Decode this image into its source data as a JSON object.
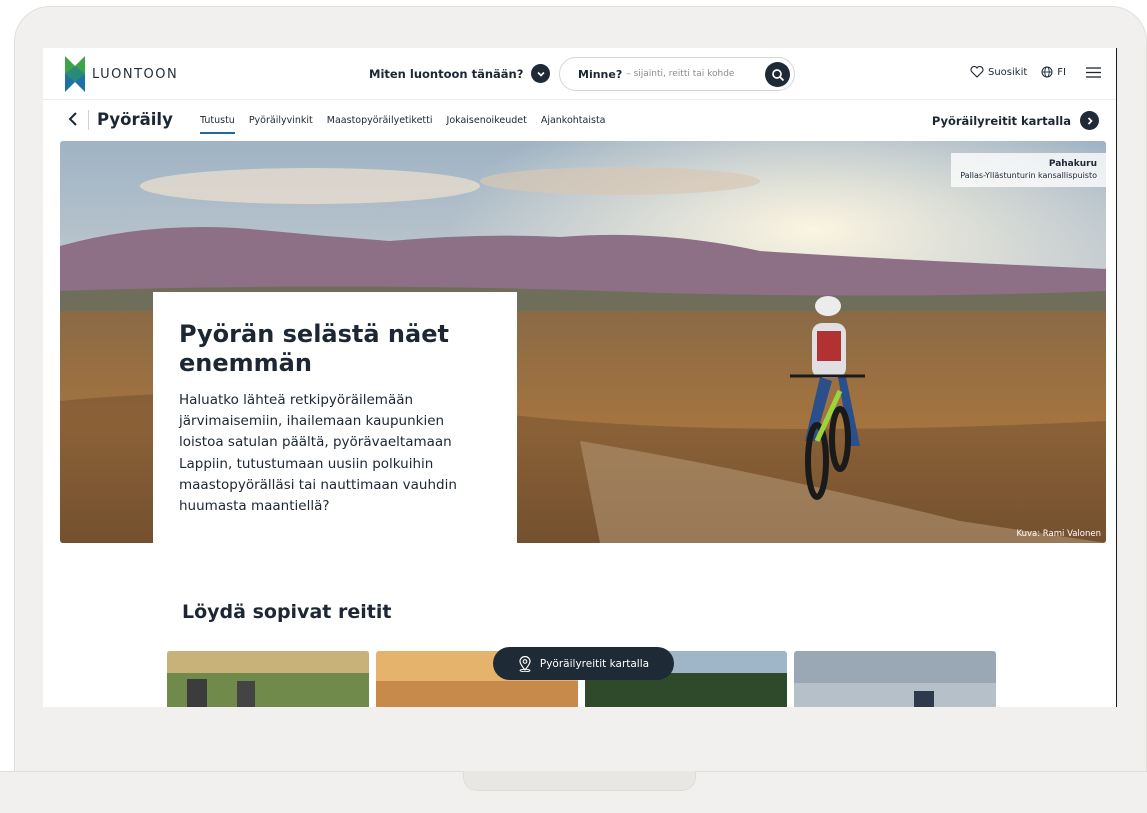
{
  "header": {
    "logo_text": "LUONTOON",
    "question": "Miten luontoon tänään?",
    "search": {
      "label": "Minne?",
      "placeholder": "– sijainti, reitti tai kohde"
    },
    "favorites": "Suosikit",
    "language": "FI"
  },
  "subnav": {
    "title": "Pyöräily",
    "tabs": [
      {
        "label": "Tutustu",
        "active": true
      },
      {
        "label": "Pyöräilyvinkit",
        "active": false
      },
      {
        "label": "Maastopyöräilyetiketti",
        "active": false
      },
      {
        "label": "Jokaisenoikeudet",
        "active": false
      },
      {
        "label": "Ajankohtaista",
        "active": false
      }
    ],
    "map_link": "Pyöräilyreitit kartalla"
  },
  "hero": {
    "place": "Pahakuru",
    "park": "Pallas-Yllästunturin kansallispuisto",
    "credit": "Kuva: Rami Valonen",
    "heading": "Pyörän selästä näet enemmän",
    "body": "Haluatko lähteä retkipyöräilemään järvimaisemiin, ihailemaan kaupunkien loistoa satulan päältä, pyörävaeltamaan Lappiin, tutustumaan uusiin polkuihin maastopyörälläsi tai nauttimaan vauhdin huumasta maantiellä?"
  },
  "routes": {
    "title": "Löydä sopivat reitit",
    "map_button": "Pyöräilyreitit kartalla"
  },
  "colors": {
    "dark": "#1e2a36",
    "accent": "#1e6a9e",
    "logo_green": "#3ea24a",
    "logo_blue": "#1f6fa8"
  },
  "icons": [
    "chevron-down-icon",
    "search-icon",
    "heart-icon",
    "globe-icon",
    "menu-icon",
    "back-icon",
    "chevron-right-icon",
    "map-pin-icon"
  ]
}
